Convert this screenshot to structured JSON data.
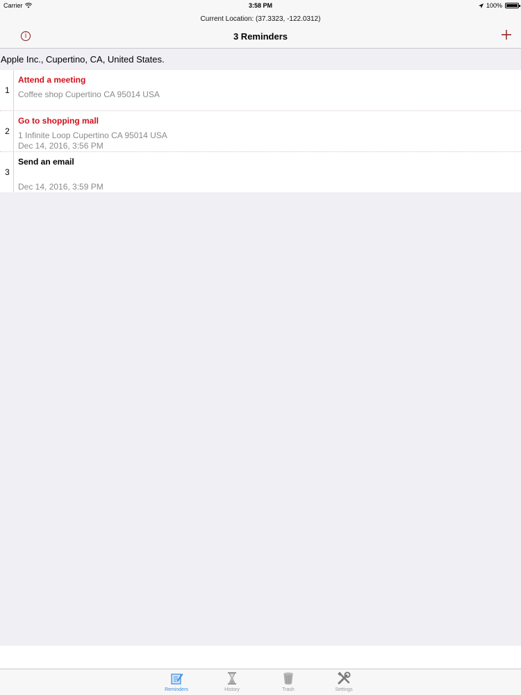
{
  "status_bar": {
    "carrier": "Carrier",
    "time": "3:58 PM",
    "battery": "100%",
    "battery_level": 1.0
  },
  "header": {
    "current_location": "Current Location: (37.3323, -122.0312)",
    "title": "3 Reminders",
    "info_icon": "info-icon",
    "add_icon": "plus-icon",
    "accent_color": "#8b1a1a"
  },
  "location": {
    "address": "Apple Inc., Cupertino, CA, United States."
  },
  "reminders": [
    {
      "index": "1",
      "title": "Attend a meeting",
      "line2": "Coffee shop Cupertino CA 95014 USA",
      "line3": "",
      "title_color": "#d0111b"
    },
    {
      "index": "2",
      "title": "Go to shopping mall",
      "line2": "1 Infinite Loop Cupertino CA 95014 USA",
      "line3": "Dec 14, 2016, 3:56 PM",
      "title_color": "#d0111b"
    },
    {
      "index": "3",
      "title": "Send an email",
      "line2": "",
      "line3": "Dec 14, 2016, 3:59 PM",
      "title_color": "#000000"
    }
  ],
  "tabs": [
    {
      "label": "Reminders",
      "icon": "reminders-icon",
      "active": true
    },
    {
      "label": "History",
      "icon": "hourglass-icon",
      "active": false
    },
    {
      "label": "Trash",
      "icon": "trash-icon",
      "active": false
    },
    {
      "label": "Settings",
      "icon": "tools-icon",
      "active": false
    }
  ]
}
